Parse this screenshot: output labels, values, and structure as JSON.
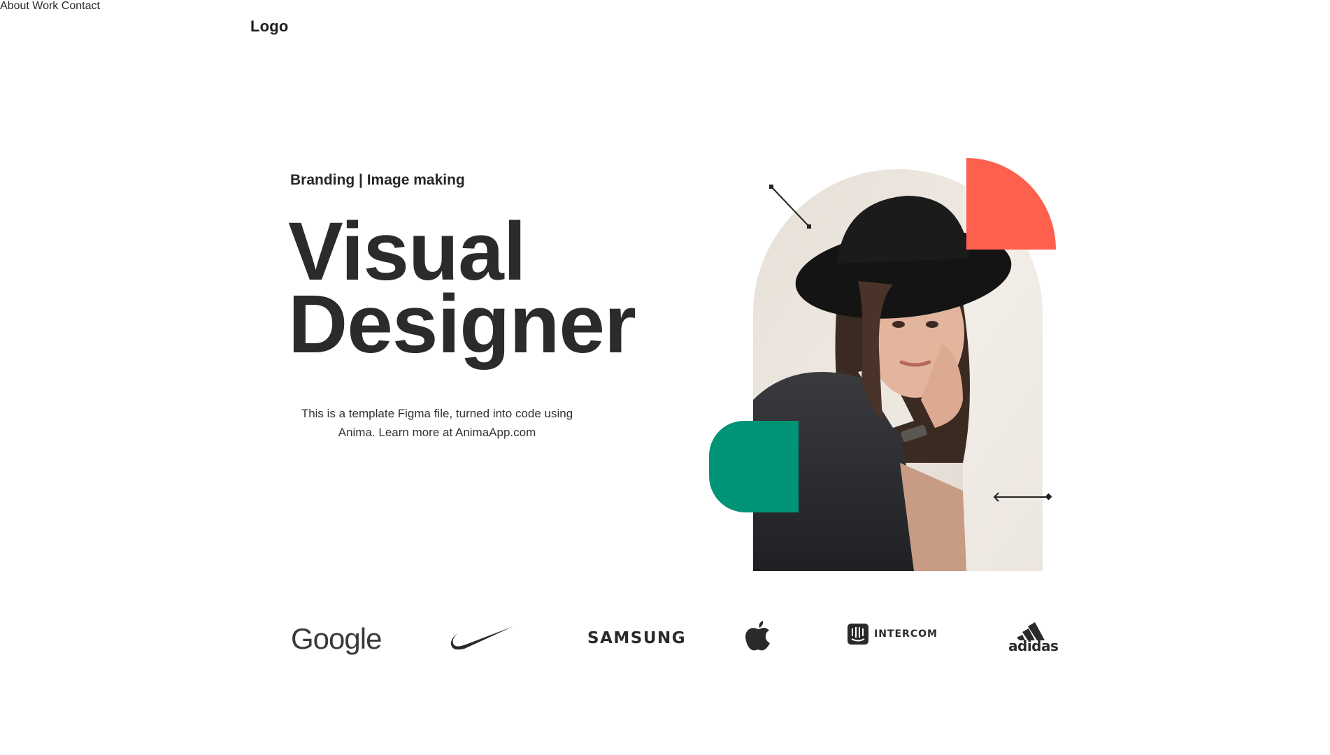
{
  "header": {
    "logo": "Logo",
    "nav": [
      {
        "label": "About"
      },
      {
        "label": "Work"
      },
      {
        "label": "Contact"
      }
    ]
  },
  "hero": {
    "eyebrow": "Branding | Image making",
    "title_line1": "Visual",
    "title_line2": "Designer",
    "description": "This is a template Figma file, turned into code using Anima. Learn more at AnimaApp.com",
    "colors": {
      "coral": "#fe604e",
      "green": "#009477",
      "text": "#2b2b2b"
    }
  },
  "brands": [
    {
      "name": "Google",
      "icon": "google-logo"
    },
    {
      "name": "Nike",
      "icon": "nike-swoosh-logo"
    },
    {
      "name": "SAMSUNG",
      "icon": "samsung-logo"
    },
    {
      "name": "Apple",
      "icon": "apple-logo"
    },
    {
      "name": "INTERCOM",
      "icon": "intercom-logo"
    },
    {
      "name": "adidas",
      "icon": "adidas-logo"
    }
  ]
}
